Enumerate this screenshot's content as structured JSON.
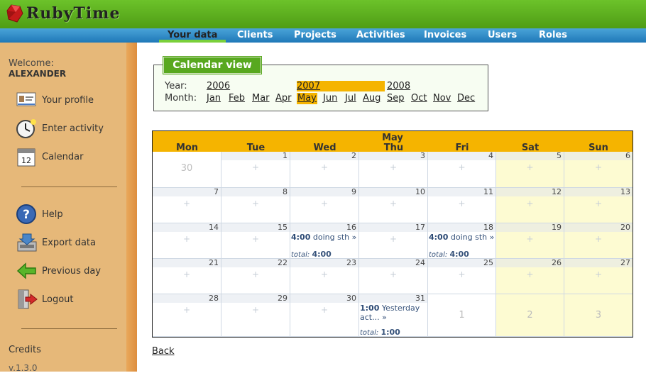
{
  "app": {
    "logo_text": "RubyTime"
  },
  "nav": {
    "items": [
      "Your data",
      "Clients",
      "Projects",
      "Activities",
      "Invoices",
      "Users",
      "Roles"
    ],
    "active": "Your data"
  },
  "sidebar": {
    "welcome": "Welcome:",
    "user": "ALEXANDER",
    "items": [
      {
        "label": "Your profile",
        "icon": "profile-card-icon"
      },
      {
        "label": "Enter activity",
        "icon": "clock-icon"
      },
      {
        "label": "Calendar",
        "icon": "calendar-icon"
      },
      {
        "label": "Help",
        "icon": "help-icon"
      },
      {
        "label": "Export data",
        "icon": "export-icon"
      },
      {
        "label": "Previous day",
        "icon": "back-arrow-icon"
      },
      {
        "label": "Logout",
        "icon": "logout-door-icon"
      }
    ],
    "credits": "Credits",
    "version": "v.1.3.0"
  },
  "calendar_view": {
    "title": "Calendar view",
    "year_label": "Year:",
    "month_label": "Month:",
    "years": [
      "2006",
      "2007",
      "2008"
    ],
    "selected_year": "2007",
    "months": [
      "Jan",
      "Feb",
      "Mar",
      "Apr",
      "May",
      "Jun",
      "Jul",
      "Aug",
      "Sep",
      "Oct",
      "Nov",
      "Dec"
    ],
    "selected_month": "May"
  },
  "calendar": {
    "month": "May",
    "days_of_week": [
      "Mon",
      "Tue",
      "Wed",
      "Thu",
      "Fri",
      "Sat",
      "Sun"
    ],
    "weeks": [
      [
        {
          "d": "30",
          "other": true
        },
        {
          "d": "1"
        },
        {
          "d": "2"
        },
        {
          "d": "3"
        },
        {
          "d": "4"
        },
        {
          "d": "5"
        },
        {
          "d": "6"
        }
      ],
      [
        {
          "d": "7"
        },
        {
          "d": "8"
        },
        {
          "d": "9"
        },
        {
          "d": "10"
        },
        {
          "d": "11"
        },
        {
          "d": "12"
        },
        {
          "d": "13"
        }
      ],
      [
        {
          "d": "14"
        },
        {
          "d": "15"
        },
        {
          "d": "16",
          "entry": "4:00",
          "text": "doing sth »",
          "total": "4:00"
        },
        {
          "d": "17"
        },
        {
          "d": "18",
          "entry": "4:00",
          "text": "doing sth »",
          "total": "4:00"
        },
        {
          "d": "19"
        },
        {
          "d": "20"
        }
      ],
      [
        {
          "d": "21"
        },
        {
          "d": "22"
        },
        {
          "d": "23"
        },
        {
          "d": "24"
        },
        {
          "d": "25"
        },
        {
          "d": "26"
        },
        {
          "d": "27"
        }
      ],
      [
        {
          "d": "28"
        },
        {
          "d": "29"
        },
        {
          "d": "30"
        },
        {
          "d": "31",
          "entry": "1:00",
          "text": "Yesterday act... »",
          "total": "1:00"
        },
        {
          "d": "1",
          "other": true
        },
        {
          "d": "2",
          "other": true
        },
        {
          "d": "3",
          "other": true
        }
      ]
    ],
    "plus": "+",
    "total_label": "total:"
  },
  "back_link": "Back"
}
